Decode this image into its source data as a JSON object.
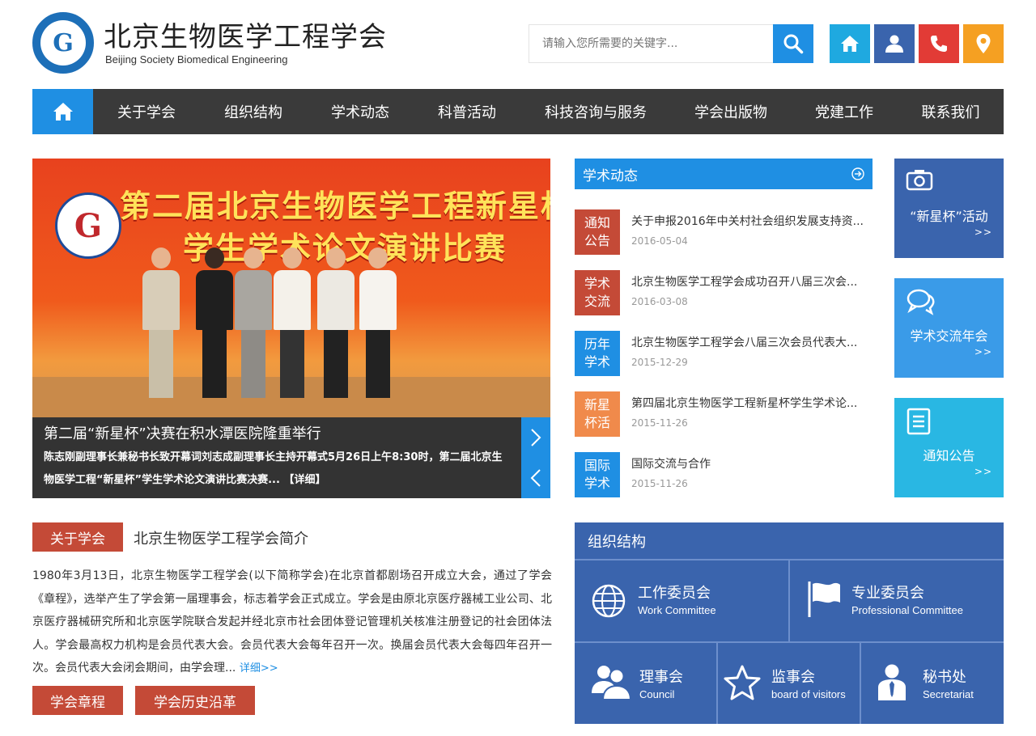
{
  "header": {
    "title": "北京生物医学工程学会",
    "subtitle": "Beijing Society Biomedical Engineering",
    "logo_letter": "G",
    "search_placeholder": "请输入您所需要的关键字..."
  },
  "quick_icons": [
    {
      "name": "home",
      "color": "#1fa9e0"
    },
    {
      "name": "user",
      "color": "#3a64ad"
    },
    {
      "name": "phone",
      "color": "#e23b36"
    },
    {
      "name": "location",
      "color": "#f5a022"
    }
  ],
  "nav": {
    "items": [
      "关于学会",
      "组织结构",
      "学术动态",
      "科普活动",
      "科技咨询与服务",
      "学会出版物",
      "党建工作",
      "联系我们"
    ]
  },
  "slider": {
    "banner_line1": "第二届北京生物医学工程新星杯",
    "banner_line2": "学生学术论文演讲比赛",
    "caption_title": "第二届“新星杯”决赛在积水潭医院隆重举行",
    "caption_text": "陈志刚副理事长兼秘书长致开幕词刘志成副理事长主持开幕式5月26日上午8:30时，第二届北京生物医学工程“新星杯”学生学术论文演讲比赛决赛... ",
    "caption_more": "【详细】"
  },
  "news": {
    "heading": "学术动态",
    "items": [
      {
        "tag": "通知公告",
        "tag_color": "#c44a37",
        "title": "关于申报2016年中关村社会组织发展支持资...",
        "date": "2016-05-04"
      },
      {
        "tag": "学术交流",
        "tag_color": "#c44a37",
        "title": "北京生物医学工程学会成功召开八届三次会...",
        "date": "2016-03-08"
      },
      {
        "tag": "历年学术",
        "tag_color": "#1f8fe3",
        "title": "北京生物医学工程学会八届三次会员代表大...",
        "date": "2015-12-29"
      },
      {
        "tag": "新星杯活",
        "tag_color": "#f08a4b",
        "title": "第四届北京生物医学工程新星杯学生学术论...",
        "date": "2015-11-26"
      },
      {
        "tag": "国际学术",
        "tag_color": "#1f8fe3",
        "title": "国际交流与合作",
        "date": "2015-11-26"
      }
    ]
  },
  "quick_links": [
    {
      "label": "“新星杯”活动",
      "more": ">>",
      "color": "#3a64ad",
      "icon": "camera-icon"
    },
    {
      "label": "学术交流年会",
      "more": ">>",
      "color": "#3a9be8",
      "icon": "chat-icon"
    },
    {
      "label": "通知公告",
      "more": ">>",
      "color": "#29b7e3",
      "icon": "notice-icon"
    }
  ],
  "about": {
    "tag": "关于学会",
    "title": "北京生物医学工程学会简介",
    "text": "1980年3月13日，北京生物医学工程学会(以下简称学会)在北京首都剧场召开成立大会，通过了学会《章程》，选举产生了学会第一届理事会，标志着学会正式成立。学会是由原北京医疗器械工业公司、北京医疗器械研究所和北京医学院联合发起并经北京市社会团体登记管理机关核准注册登记的社会团体法人。学会最高权力机构是会员代表大会。会员代表大会每年召开一次。换届会员代表大会每四年召开一次。会员代表大会闭会期间，由学会理... ",
    "more": "详细>>",
    "buttons": [
      "学会章程",
      "学会历史沿革"
    ]
  },
  "org": {
    "title": "组织结构",
    "cells": [
      {
        "cn": "工作委员会",
        "en": "Work Committee",
        "icon": "globe-icon"
      },
      {
        "cn": "专业委员会",
        "en": "Professional Committee",
        "icon": "flag-icon"
      },
      {
        "cn": "理事会",
        "en": "Council",
        "icon": "people-icon"
      },
      {
        "cn": "监事会",
        "en": "board of visitors",
        "icon": "star-icon"
      },
      {
        "cn": "秘书处",
        "en": "Secretariat",
        "icon": "tie-icon"
      }
    ]
  }
}
